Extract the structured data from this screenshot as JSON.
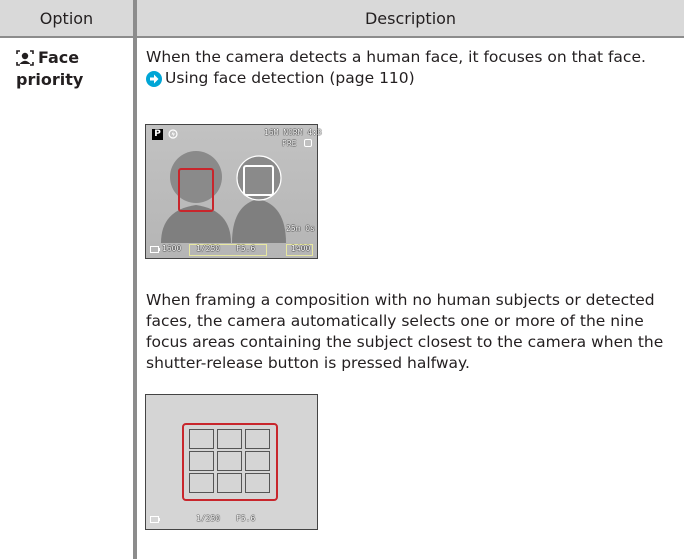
{
  "table": {
    "header": {
      "option": "Option",
      "description": "Description"
    },
    "row": {
      "option_label_1": "Face",
      "option_label_2": "priority",
      "option_icon": "face-priority-icon",
      "para1": "When the camera detects a human face, it focuses on that face.",
      "link_text": "Using face detection (page 110)",
      "link_icon": "arrow-right-circle-icon",
      "para2": "When framing a composition with no human subjects or detected faces, the camera automatically selects one or more of the nine focus areas containing the subject closest to the camera when the shutter-release button is pressed halfway."
    }
  },
  "screen1": {
    "mode": "P",
    "top_right_line1": "16M NORM 4:3",
    "top_right_line2": "PRE",
    "time_remaining": "25m 0s",
    "iso": "1600",
    "shutter": "1/250",
    "aperture": "F5.6",
    "frames": "1400"
  },
  "screen2": {
    "shutter": "1/250",
    "aperture": "F5.6"
  },
  "colors": {
    "header_bg": "#d9d9d9",
    "rule": "#8c8c8c",
    "focus_frame": "#c8262c",
    "link_arrow": "#00a6d6"
  }
}
